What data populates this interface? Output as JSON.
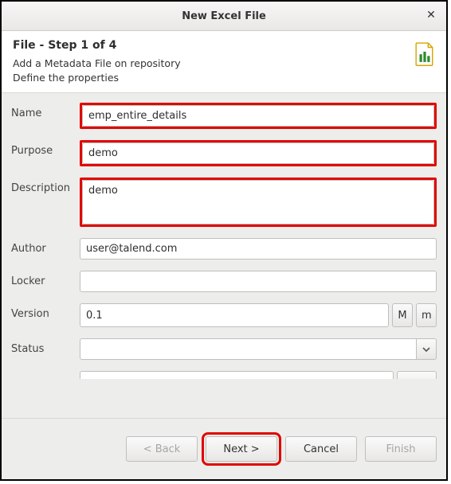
{
  "window": {
    "title": "New Excel File"
  },
  "header": {
    "title": "File - Step 1 of 4",
    "line1": "Add a Metadata File on repository",
    "line2": "Define the properties"
  },
  "form": {
    "name": {
      "label": "Name",
      "value": "emp_entire_details"
    },
    "purpose": {
      "label": "Purpose",
      "value": "demo"
    },
    "description": {
      "label": "Description",
      "value": "demo"
    },
    "author": {
      "label": "Author",
      "value": "user@talend.com"
    },
    "locker": {
      "label": "Locker",
      "value": ""
    },
    "version": {
      "label": "Version",
      "value": "0.1",
      "btn_major": "M",
      "btn_minor": "m"
    },
    "status": {
      "label": "Status",
      "value": ""
    }
  },
  "buttons": {
    "back": "< Back",
    "next": "Next >",
    "cancel": "Cancel",
    "finish": "Finish"
  }
}
